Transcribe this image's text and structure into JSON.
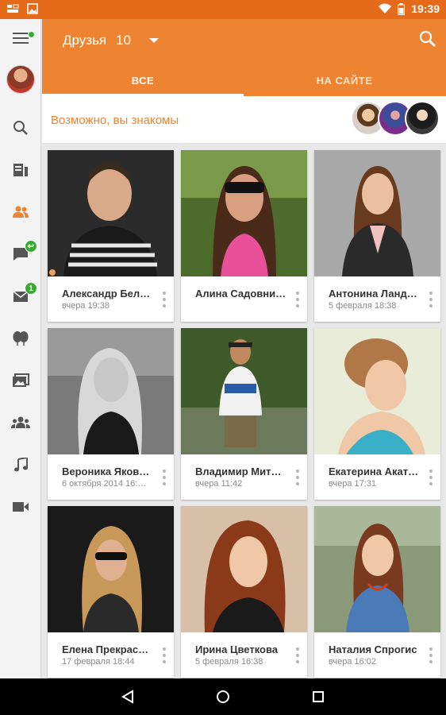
{
  "status_bar": {
    "time": "19:39",
    "icons": [
      "notification-icon",
      "image-icon",
      "wifi-icon",
      "battery-icon"
    ]
  },
  "colors": {
    "accent": "#ee8332",
    "status_bar": "#e56b1a",
    "badge": "#3aaa35"
  },
  "header": {
    "title": "Друзья",
    "count": "10",
    "search_icon": "search-icon"
  },
  "tabs": [
    {
      "label": "ВСЕ",
      "selected": true
    },
    {
      "label": "НА САЙТЕ",
      "selected": false
    }
  ],
  "suggestions": {
    "label": "Возможно, вы знакомы"
  },
  "sidebar": {
    "items": [
      {
        "icon": "menu-icon"
      },
      {
        "icon": "profile-avatar"
      },
      {
        "icon": "search-icon"
      },
      {
        "icon": "feed-icon"
      },
      {
        "icon": "friends-icon",
        "active": true
      },
      {
        "icon": "discussions-icon",
        "badge": "↩"
      },
      {
        "icon": "messages-icon",
        "badge": "1"
      },
      {
        "icon": "gifts-icon"
      },
      {
        "icon": "photos-icon"
      },
      {
        "icon": "groups-icon"
      },
      {
        "icon": "music-icon"
      },
      {
        "icon": "video-icon"
      }
    ]
  },
  "friends": [
    {
      "name": "Александр Бел…",
      "subtitle": "вчера 19:38"
    },
    {
      "name": "Алина Садовни…",
      "subtitle": ""
    },
    {
      "name": "Антонина Ланд…",
      "subtitle": "5 февраля 18:38"
    },
    {
      "name": "Вероника Яков…",
      "subtitle": "6 октября 2014 16:…"
    },
    {
      "name": "Владимир Мит…",
      "subtitle": "вчера 11:42"
    },
    {
      "name": "Екатерина Акат…",
      "subtitle": "вчера 17:31"
    },
    {
      "name": "Елена Прекрас…",
      "subtitle": "17 февраля 18:44"
    },
    {
      "name": "Ирина Цветкова",
      "subtitle": "5 февраля 16:38"
    },
    {
      "name": "Наталия Спрогис",
      "subtitle": "вчера 16:02"
    }
  ],
  "navbar": {
    "icons": [
      "back-icon",
      "home-icon",
      "recents-icon"
    ]
  }
}
